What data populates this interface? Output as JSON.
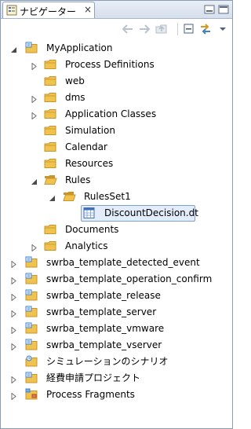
{
  "view": {
    "tab_label": "ナビゲーター",
    "close_glyph": "×"
  },
  "colors": {
    "folder": "#f0c24e",
    "folder_dark": "#c9942a",
    "project_blue": "#3d7fd0",
    "selection_bg": "#e2ecfb",
    "selection_border": "#7da2ce",
    "twisty": "#6d6d6d"
  },
  "tree": {
    "items": [
      {
        "label": "MyApplication",
        "level": 0,
        "expander": "expanded",
        "icon": "project-folder-icon"
      },
      {
        "label": "Process Definitions",
        "level": 1,
        "expander": "collapsed",
        "icon": "folder-icon"
      },
      {
        "label": "web",
        "level": 1,
        "expander": "none",
        "icon": "folder-icon"
      },
      {
        "label": "dms",
        "level": 1,
        "expander": "collapsed",
        "icon": "folder-icon"
      },
      {
        "label": "Application Classes",
        "level": 1,
        "expander": "collapsed",
        "icon": "folder-icon"
      },
      {
        "label": "Simulation",
        "level": 1,
        "expander": "none",
        "icon": "folder-icon"
      },
      {
        "label": "Calendar",
        "level": 1,
        "expander": "none",
        "icon": "folder-icon"
      },
      {
        "label": "Resources",
        "level": 1,
        "expander": "none",
        "icon": "folder-icon"
      },
      {
        "label": "Rules",
        "level": 1,
        "expander": "expanded",
        "icon": "open-folder-icon"
      },
      {
        "label": "RulesSet1",
        "level": 2,
        "expander": "expanded",
        "icon": "open-folder-icon"
      },
      {
        "label": "DiscountDecision.dt",
        "level": 3,
        "expander": "none",
        "icon": "decision-table-file-icon",
        "selected": true
      },
      {
        "label": "Documents",
        "level": 1,
        "expander": "none",
        "icon": "folder-icon"
      },
      {
        "label": "Analytics",
        "level": 1,
        "expander": "collapsed",
        "icon": "folder-icon"
      },
      {
        "label": "swrba_template_detected_event",
        "level": 0,
        "expander": "collapsed",
        "icon": "project-folder-icon"
      },
      {
        "label": "swrba_template_operation_confirm",
        "level": 0,
        "expander": "collapsed",
        "icon": "project-folder-icon"
      },
      {
        "label": "swrba_template_release",
        "level": 0,
        "expander": "collapsed",
        "icon": "project-folder-icon"
      },
      {
        "label": "swrba_template_server",
        "level": 0,
        "expander": "collapsed",
        "icon": "project-folder-icon"
      },
      {
        "label": "swrba_template_vmware",
        "level": 0,
        "expander": "collapsed",
        "icon": "project-folder-icon"
      },
      {
        "label": "swrba_template_vserver",
        "level": 0,
        "expander": "collapsed",
        "icon": "project-folder-icon"
      },
      {
        "label": "シミュレーションのシナリオ",
        "level": 0,
        "expander": "none",
        "icon": "simulation-project-icon"
      },
      {
        "label": "経費申請プロジェクト",
        "level": 0,
        "expander": "collapsed",
        "icon": "project-folder-icon"
      },
      {
        "label": "Process Fragments",
        "level": 0,
        "expander": "collapsed",
        "icon": "process-fragments-icon"
      }
    ]
  }
}
